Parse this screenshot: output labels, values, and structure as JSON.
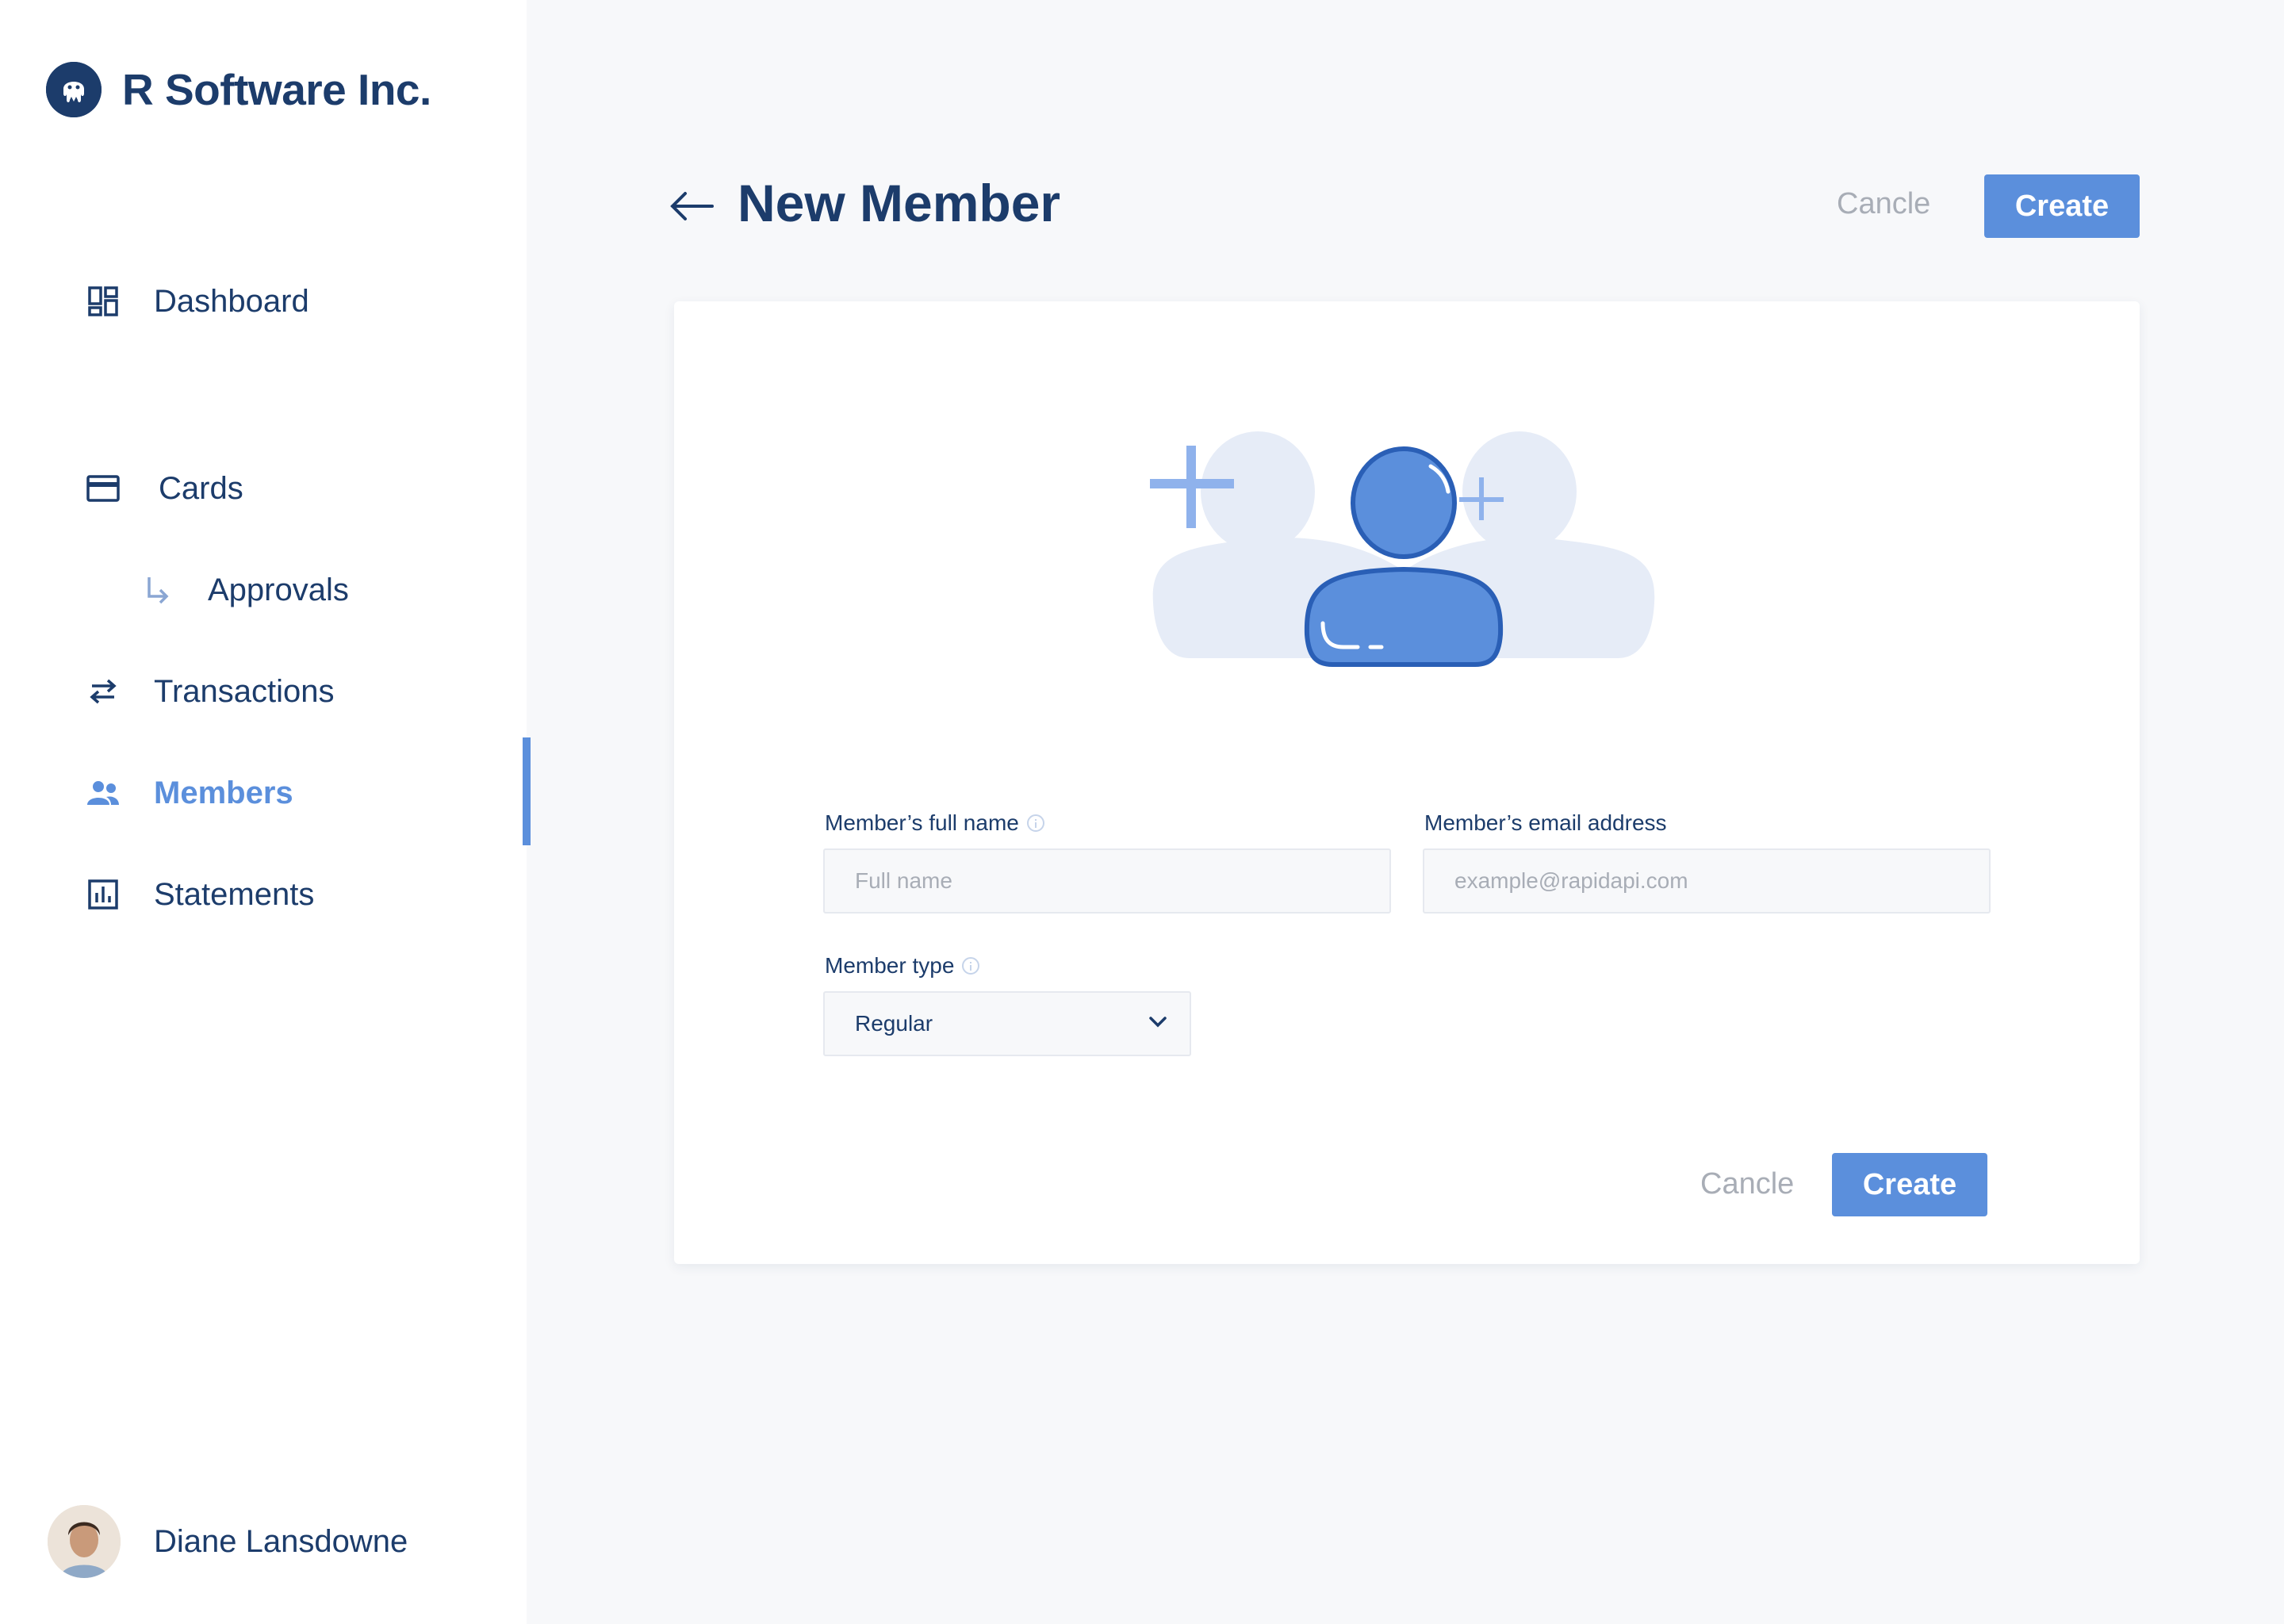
{
  "sidebar": {
    "brand_name": "R Software Inc.",
    "nav": [
      {
        "label": "Dashboard",
        "icon": "dashboard-icon"
      },
      {
        "label": "Cards",
        "icon": "credit-card-icon"
      },
      {
        "label": "Approvals",
        "icon": "subdirectory-arrow-icon"
      },
      {
        "label": "Transactions",
        "icon": "swap-arrows-icon"
      },
      {
        "label": "Members",
        "icon": "people-icon",
        "active": true
      },
      {
        "label": "Statements",
        "icon": "bar-chart-icon"
      }
    ],
    "user_name": "Diane Lansdowne"
  },
  "header": {
    "title": "New Member",
    "cancel_label": "Cancle",
    "create_label": "Create"
  },
  "form": {
    "full_name_label": "Member’s full name",
    "full_name_placeholder": "Full name",
    "email_label": "Member’s email address",
    "email_placeholder": "example@rapidapi.com",
    "type_label": "Member type",
    "type_value": "Regular",
    "cancel_label": "Cancle",
    "create_label": "Create"
  },
  "colors": {
    "primary": "#1c3c6b",
    "accent": "#5b8fdc",
    "muted": "#a8adb6",
    "background": "#f7f8fa"
  }
}
